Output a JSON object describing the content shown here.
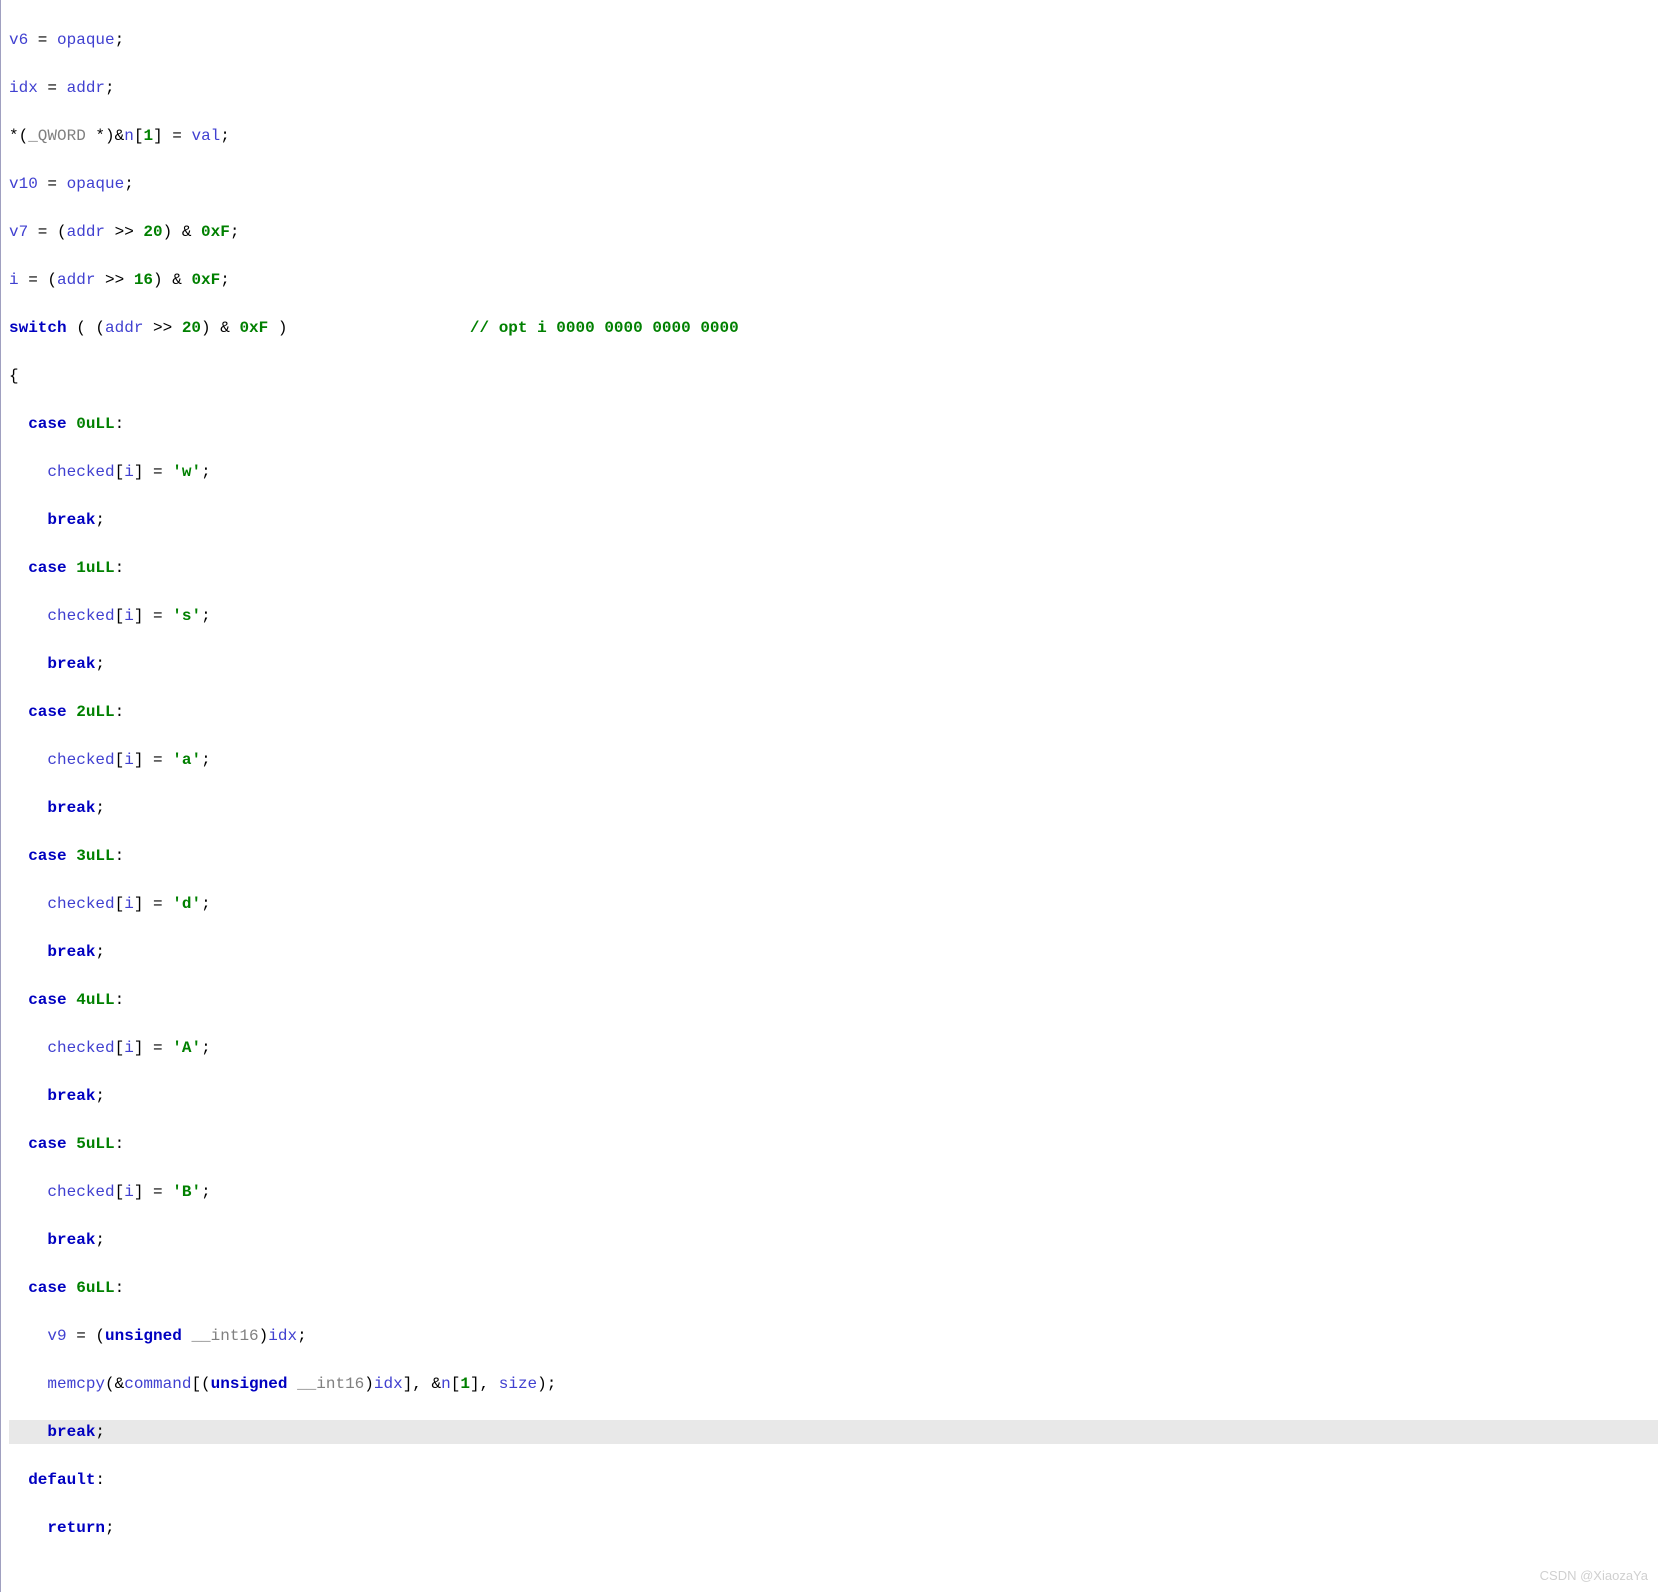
{
  "watermark": "CSDN @XiaozaYa",
  "code": {
    "l1": {
      "a": "v6",
      "b": "opaque"
    },
    "l2": {
      "a": "idx",
      "b": "addr"
    },
    "l3": {
      "a": "_QWORD ",
      "b": "n",
      "c": "1",
      "d": "val"
    },
    "l4": {
      "a": "v10",
      "b": "opaque"
    },
    "l5": {
      "a": "v7",
      "b": "addr",
      "c": "20",
      "d": "0xF"
    },
    "l6": {
      "a": "i",
      "b": "addr",
      "c": "16",
      "d": "0xF"
    },
    "l7": {
      "kw": "switch",
      "a": "addr",
      "b": "20",
      "c": "0xF",
      "cmt": "// opt i 0000 0000 0000 0000"
    },
    "l8": {
      "brace": "{"
    },
    "l9": {
      "kw": "case",
      "v": "0uLL"
    },
    "l10": {
      "a": "checked",
      "b": "i",
      "c": "'w'"
    },
    "l11": {
      "kw": "break"
    },
    "l12": {
      "kw": "case",
      "v": "1uLL"
    },
    "l13": {
      "a": "checked",
      "b": "i",
      "c": "'s'"
    },
    "l14": {
      "kw": "break"
    },
    "l15": {
      "kw": "case",
      "v": "2uLL"
    },
    "l16": {
      "a": "checked",
      "b": "i",
      "c": "'a'"
    },
    "l17": {
      "kw": "break"
    },
    "l18": {
      "kw": "case",
      "v": "3uLL"
    },
    "l19": {
      "a": "checked",
      "b": "i",
      "c": "'d'"
    },
    "l20": {
      "kw": "break"
    },
    "l21": {
      "kw": "case",
      "v": "4uLL"
    },
    "l22": {
      "a": "checked",
      "b": "i",
      "c": "'A'"
    },
    "l23": {
      "kw": "break"
    },
    "l24": {
      "kw": "case",
      "v": "5uLL"
    },
    "l25": {
      "a": "checked",
      "b": "i",
      "c": "'B'"
    },
    "l26": {
      "kw": "break"
    },
    "l27": {
      "kw": "case",
      "v": "6uLL"
    },
    "l28": {
      "a": "v9",
      "t": "unsigned ",
      "u": "__int16",
      "b": "idx"
    },
    "l29": {
      "fn": "memcpy",
      "a": "command",
      "t": "unsigned ",
      "u": "__int16",
      "b": "idx",
      "c": "n",
      "d": "1",
      "e": "size"
    },
    "l30": {
      "kw": "break"
    },
    "l31": {
      "kw": "default"
    },
    "l32": {
      "kw": "return"
    }
  }
}
